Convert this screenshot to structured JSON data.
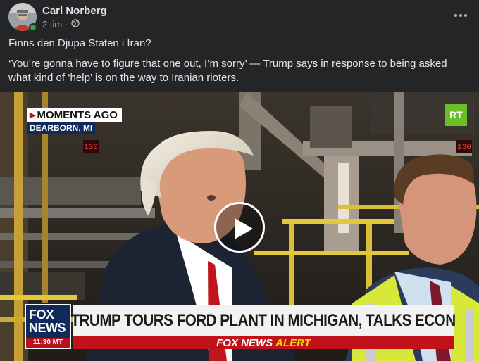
{
  "post": {
    "author": "Carl Norberg",
    "time": "2 tim",
    "separator": "·",
    "visibility_icon": "globe-icon",
    "more_icon": "more-options-icon",
    "text_line1": "Finns den Djupa Staten i Iran?",
    "text_line2": "‘You’re gonna have to figure that one out, I’m sorry’ — Trump says in response to being asked what kind of ‘help’ is on the way to Iranian rioters."
  },
  "video": {
    "play_icon": "play-icon",
    "overlay": {
      "moments_label": "MOMENTS AGO",
      "location": "DEARBORN, MI",
      "channel_badge": "RT",
      "network_line1": "FOX",
      "network_line2": "NEWS",
      "network_time": "11:30 MT",
      "headline": "TRUMP TOURS FORD PLANT IN MICHIGAN, TALKS ECON",
      "alert_white": "FOX NEWS",
      "alert_yellow": "ALERT",
      "stripe_tag_1": "130",
      "stripe_tag_2": "130"
    }
  },
  "colors": {
    "background": "#242526",
    "text_primary": "#e4e6eb",
    "text_secondary": "#b0b3b8",
    "online": "#31a24c",
    "fox_red": "#c1121c",
    "fox_blue": "#0f2a5b",
    "alert_yellow": "#ffd400",
    "rt_green": "#6bbf26"
  }
}
